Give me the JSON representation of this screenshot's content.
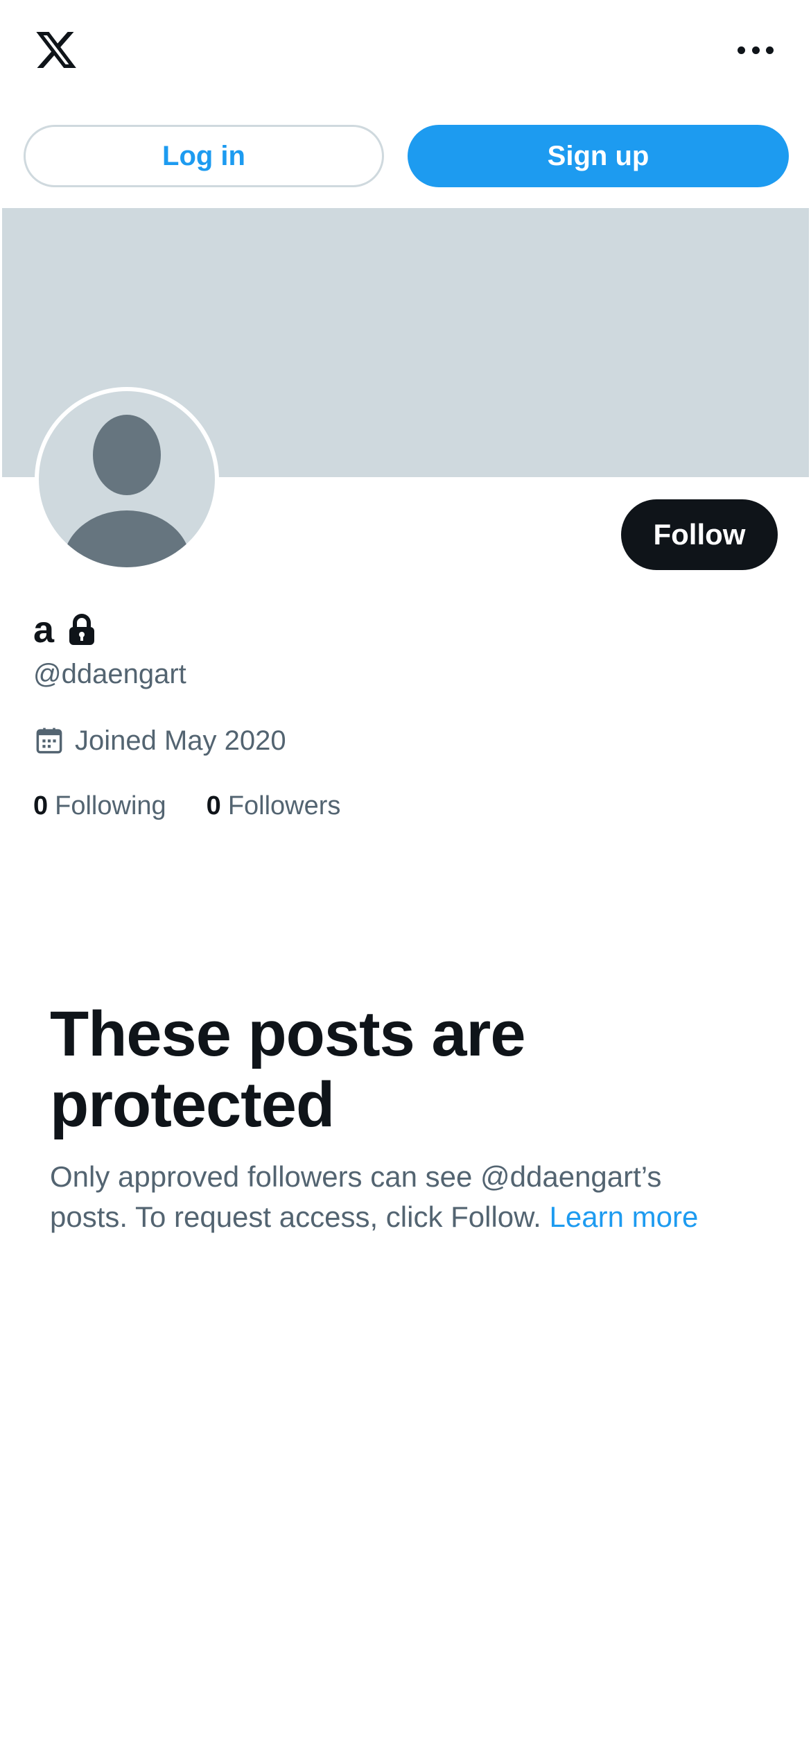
{
  "header": {
    "logo_icon": "x-logo-icon",
    "more_icon": "more-horizontal-icon"
  },
  "auth": {
    "login_label": "Log in",
    "signup_label": "Sign up"
  },
  "profile": {
    "display_name": "a",
    "handle": "@ddaengart",
    "joined": "Joined May 2020",
    "following_count": "0",
    "following_label": "Following",
    "followers_count": "0",
    "followers_label": "Followers",
    "follow_label": "Follow",
    "lock_icon": "lock-icon",
    "calendar_icon": "calendar-icon"
  },
  "protected": {
    "title": "These posts are protected",
    "body": "Only approved followers can see @ddaengart’s posts. To request access, click Follow.",
    "learn_more": "Learn more"
  },
  "colors": {
    "accent": "#1d9bf0",
    "text_primary": "#0f1419",
    "text_secondary": "#536471",
    "banner": "#cfd9de",
    "avatar_figure": "#66757f"
  }
}
